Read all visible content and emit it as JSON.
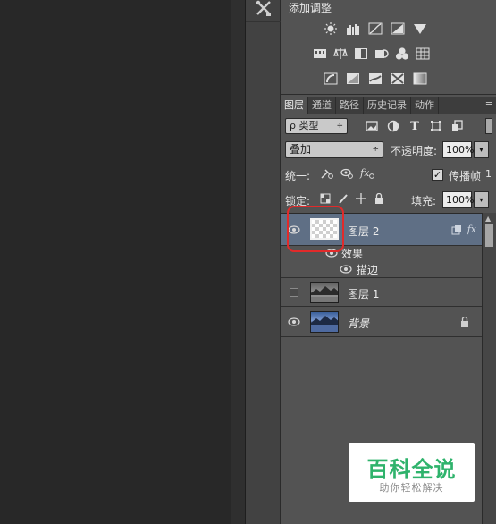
{
  "adjustments": {
    "title": "添加调整",
    "row1_icons": [
      "brightness-icon",
      "levels-icon",
      "curves-icon",
      "exposure-icon",
      "vibrance-icon"
    ],
    "row2_icons": [
      "hue-saturation-icon",
      "color-balance-icon",
      "black-white-icon",
      "photo-filter-icon",
      "channel-mixer-icon",
      "color-lookup-icon"
    ],
    "row3_icons": [
      "invert-icon",
      "posterize-icon",
      "threshold-icon",
      "selective-color-icon",
      "gradient-map-icon"
    ]
  },
  "layers_panel": {
    "tabs": [
      "图层",
      "通道",
      "路径",
      "历史记录",
      "动作"
    ],
    "menu_icon": "≡",
    "filter": {
      "value": "ρ 类型",
      "arrow": "÷"
    },
    "filter_icons": [
      "image-filter-icon",
      "adjustment-filter-icon",
      "T",
      "shape-filter-icon",
      "smart-object-filter-icon"
    ],
    "blend_mode": {
      "value": "叠加",
      "arrow": "÷"
    },
    "opacity": {
      "label": "不透明度:",
      "value": "100%",
      "arrow": "▾"
    },
    "unify": {
      "label": "统一:",
      "propagate_label": "传播帧",
      "propagate_checked": "✓",
      "propagate_num": "1"
    },
    "lock": {
      "label": "锁定:",
      "fill_label": "填充:",
      "fill_value": "100%",
      "arrow": "▾"
    },
    "layers": [
      {
        "name": "图层 2",
        "visible": true,
        "selected": true,
        "fx": "fx",
        "thumb": "transparent"
      },
      {
        "effects_label": "效果",
        "stroke_label": "描边"
      },
      {
        "name": "图层 1",
        "visible": false,
        "selected": false,
        "thumb": "landscape"
      },
      {
        "name": "背景",
        "visible": true,
        "selected": false,
        "locked": true,
        "thumb": "landscape-blue"
      }
    ]
  },
  "watermark": {
    "title": "百科全说",
    "subtitle": "助你轻松解决"
  },
  "colors": {
    "selected_row": "#5f6f85",
    "highlight": "#e22a2a",
    "watermark_green": "#2fb36c"
  }
}
